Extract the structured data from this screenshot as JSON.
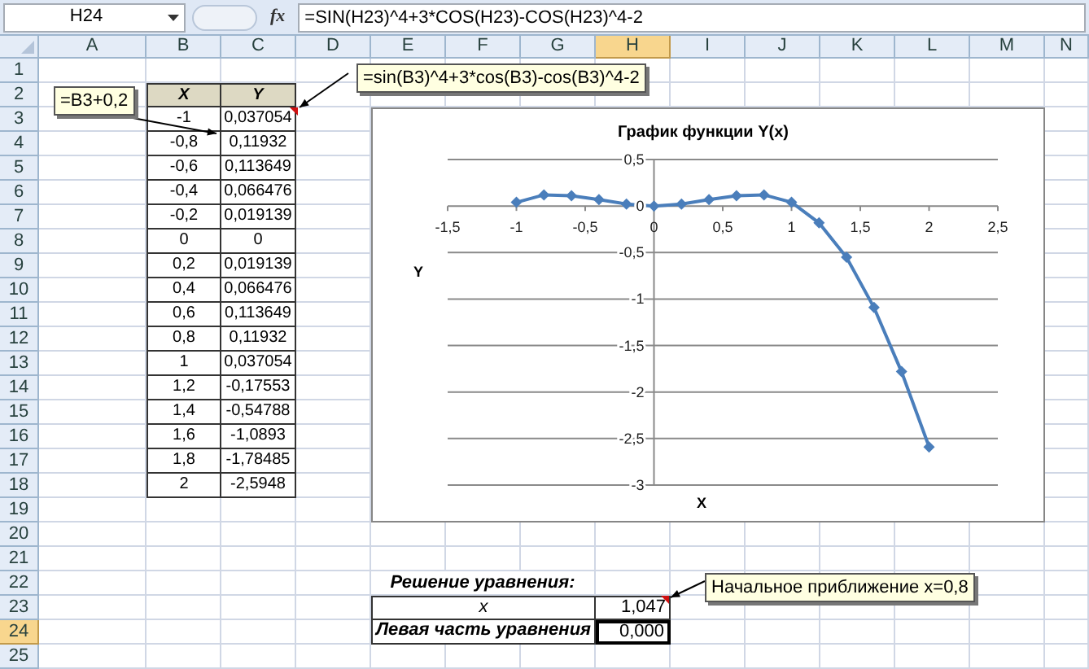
{
  "formula_bar": {
    "name_box": "H24",
    "fx_label": "fx",
    "formula": "=SIN(H23)^4+3*COS(H23)-COS(H23)^4-2"
  },
  "columns": [
    {
      "label": "A",
      "selected": false
    },
    {
      "label": "B",
      "selected": false
    },
    {
      "label": "C",
      "selected": false
    },
    {
      "label": "D",
      "selected": false
    },
    {
      "label": "E",
      "selected": false
    },
    {
      "label": "F",
      "selected": false
    },
    {
      "label": "G",
      "selected": false
    },
    {
      "label": "H",
      "selected": true
    },
    {
      "label": "I",
      "selected": false
    },
    {
      "label": "J",
      "selected": false
    },
    {
      "label": "K",
      "selected": false
    },
    {
      "label": "L",
      "selected": false
    },
    {
      "label": "M",
      "selected": false
    },
    {
      "label": "N",
      "selected": false
    }
  ],
  "rows": [
    {
      "label": "1",
      "selected": false
    },
    {
      "label": "2",
      "selected": false
    },
    {
      "label": "3",
      "selected": false
    },
    {
      "label": "4",
      "selected": false
    },
    {
      "label": "5",
      "selected": false
    },
    {
      "label": "6",
      "selected": false
    },
    {
      "label": "7",
      "selected": false
    },
    {
      "label": "8",
      "selected": false
    },
    {
      "label": "9",
      "selected": false
    },
    {
      "label": "10",
      "selected": false
    },
    {
      "label": "11",
      "selected": false
    },
    {
      "label": "12",
      "selected": false
    },
    {
      "label": "13",
      "selected": false
    },
    {
      "label": "14",
      "selected": false
    },
    {
      "label": "15",
      "selected": false
    },
    {
      "label": "16",
      "selected": false
    },
    {
      "label": "17",
      "selected": false
    },
    {
      "label": "18",
      "selected": false
    },
    {
      "label": "19",
      "selected": false
    },
    {
      "label": "20",
      "selected": false
    },
    {
      "label": "21",
      "selected": false
    },
    {
      "label": "22",
      "selected": false
    },
    {
      "label": "23",
      "selected": false
    },
    {
      "label": "24",
      "selected": true
    },
    {
      "label": "25",
      "selected": false
    }
  ],
  "table": {
    "columns": [
      "X",
      "Y"
    ],
    "rows": [
      [
        "-1",
        "0,037054"
      ],
      [
        "-0,8",
        "0,11932"
      ],
      [
        "-0,6",
        "0,113649"
      ],
      [
        "-0,4",
        "0,066476"
      ],
      [
        "-0,2",
        "0,019139"
      ],
      [
        "0",
        "0"
      ],
      [
        "0,2",
        "0,019139"
      ],
      [
        "0,4",
        "0,066476"
      ],
      [
        "0,6",
        "0,113649"
      ],
      [
        "0,8",
        "0,11932"
      ],
      [
        "1",
        "0,037054"
      ],
      [
        "1,2",
        "-0,17553"
      ],
      [
        "1,4",
        "-0,54788"
      ],
      [
        "1,6",
        "-1,0893"
      ],
      [
        "1,8",
        "-1,78485"
      ],
      [
        "2",
        "-2,5948"
      ]
    ]
  },
  "comments": [
    {
      "text": "=B3+0,2"
    },
    {
      "text": "=sin(B3)^4+3*cos(B3)-cos(B3)^4-2"
    },
    {
      "text": "Начальное приближение x=0,8"
    }
  ],
  "chart": {
    "chart_data": {
      "type": "line",
      "title": "График функции Y(x)",
      "xlabel": "X",
      "ylabel": "Y",
      "x": [
        -1,
        -0.8,
        -0.6,
        -0.4,
        -0.2,
        0,
        0.2,
        0.4,
        0.6,
        0.8,
        1,
        1.2,
        1.4,
        1.6,
        1.8,
        2
      ],
      "series": [
        {
          "color": "#4a7ebb",
          "marker": "diamond",
          "values": [
            0.04,
            0.12,
            0.11,
            0.07,
            0.02,
            0,
            0.02,
            0.07,
            0.11,
            0.12,
            0.04,
            -0.18,
            -0.55,
            -1.09,
            -1.78,
            -2.59
          ]
        }
      ],
      "grid": true,
      "xlim": [
        -1.5,
        2.5
      ],
      "ylim": [
        -3,
        0.5
      ],
      "xticks": [
        {
          "value": -1.5,
          "label": "-1,5"
        },
        {
          "value": -1,
          "label": "-1"
        },
        {
          "value": -0.5,
          "label": "-0,5"
        },
        {
          "value": 0,
          "label": "0"
        },
        {
          "value": 0.5,
          "label": "0,5"
        },
        {
          "value": 1,
          "label": "1"
        },
        {
          "value": 1.5,
          "label": "1,5"
        },
        {
          "value": 2,
          "label": "2"
        },
        {
          "value": 2.5,
          "label": "2,5"
        }
      ],
      "yticks": [
        {
          "value": 0.5,
          "label": "0,5"
        },
        {
          "value": 0,
          "label": "0"
        },
        {
          "value": -0.5,
          "label": "-0,5"
        },
        {
          "value": -1,
          "label": "-1"
        },
        {
          "value": -1.5,
          "label": "-1,5"
        },
        {
          "value": -2,
          "label": "-2"
        },
        {
          "value": -2.5,
          "label": "-2,5"
        },
        {
          "value": -3,
          "label": "-3"
        }
      ]
    }
  },
  "solution": {
    "title": "Решение уравнения:",
    "rows": [
      {
        "label": "x",
        "value": "1,047",
        "selected": false
      },
      {
        "label": "Левая часть уравнения",
        "value": "0,000",
        "selected": true
      }
    ]
  }
}
